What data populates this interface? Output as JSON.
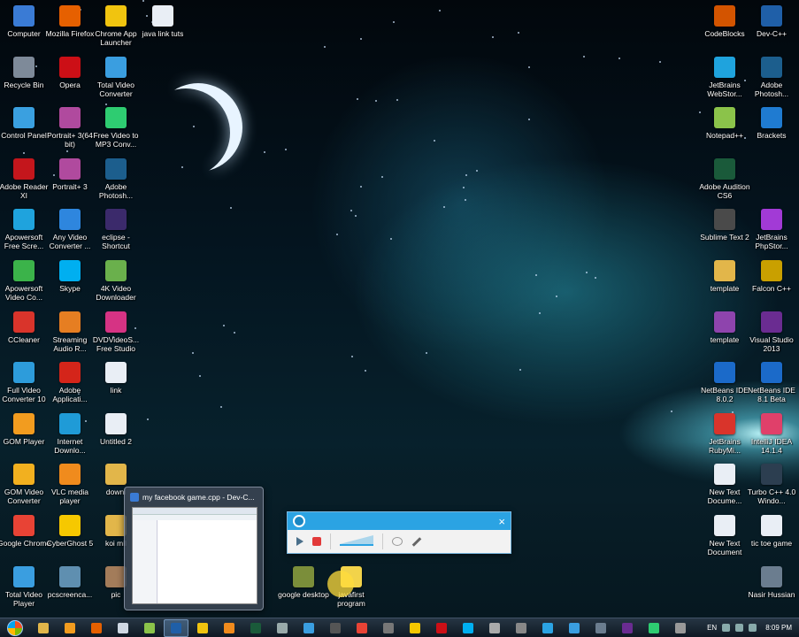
{
  "desktop": {
    "icons_left": [
      {
        "label": "Computer",
        "icon": "computer-icon",
        "color": "#3a7bd5"
      },
      {
        "label": "Recycle Bin",
        "icon": "recycle-bin-icon",
        "color": "#7e8a99"
      },
      {
        "label": "Control Panel",
        "icon": "control-panel-icon",
        "color": "#3aa0e0"
      },
      {
        "label": "Adobe Reader XI",
        "icon": "adobe-reader-icon",
        "color": "#c4161c"
      },
      {
        "label": "Apowersoft Free Scre...",
        "icon": "apowersoft-icon",
        "color": "#1fa3dd"
      },
      {
        "label": "Apowersoft Video Co...",
        "icon": "apowersoft-video-icon",
        "color": "#3bb34a"
      },
      {
        "label": "CCleaner",
        "icon": "ccleaner-icon",
        "color": "#d9342b"
      },
      {
        "label": "Full Video Converter 10",
        "icon": "full-video-converter-icon",
        "color": "#2d9cdb"
      },
      {
        "label": "GOM Player",
        "icon": "gom-player-icon",
        "color": "#f29c1f"
      },
      {
        "label": "GOM Video Converter",
        "icon": "gom-video-converter-icon",
        "color": "#f2b01f"
      },
      {
        "label": "Google Chrome",
        "icon": "chrome-icon",
        "color": "#e84335"
      },
      {
        "label": "Total Video Player",
        "icon": "total-video-player-icon",
        "color": "#3a9ee0"
      }
    ],
    "icons_col2": [
      {
        "label": "Mozilla Firefox",
        "icon": "firefox-icon",
        "color": "#e66000"
      },
      {
        "label": "Opera",
        "icon": "opera-icon",
        "color": "#cc0f16"
      },
      {
        "label": "Portrait+ 3(64 bit)",
        "icon": "portrait-icon",
        "color": "#b04a9e"
      },
      {
        "label": "Portrait+ 3",
        "icon": "portrait-icon",
        "color": "#b04a9e"
      },
      {
        "label": "Any Video Converter ...",
        "icon": "any-video-converter-icon",
        "color": "#2e86de"
      },
      {
        "label": "Skype",
        "icon": "skype-icon",
        "color": "#00aff0"
      },
      {
        "label": "Streaming Audio R...",
        "icon": "streaming-audio-icon",
        "color": "#e67e22"
      },
      {
        "label": "Adobe Applicati...",
        "icon": "adobe-app-icon",
        "color": "#d4251a"
      },
      {
        "label": "Internet Downlo...",
        "icon": "internet-download-icon",
        "color": "#1f9bd7"
      },
      {
        "label": "VLC media player",
        "icon": "vlc-icon",
        "color": "#f08b1d"
      },
      {
        "label": "CyberGhost 5",
        "icon": "cyberghost-icon",
        "color": "#f6c800"
      },
      {
        "label": "pcscreenca...",
        "icon": "screencast-icon",
        "color": "#5f8fb0"
      }
    ],
    "icons_col3": [
      {
        "label": "Chrome App Launcher",
        "icon": "chrome-app-launcher-icon",
        "color": "#f1c40f"
      },
      {
        "label": "Total Video Converter",
        "icon": "total-video-converter-icon",
        "color": "#3a9ee0"
      },
      {
        "label": "Free Video to MP3 Conv...",
        "icon": "free-video-mp3-icon",
        "color": "#2ecc71"
      },
      {
        "label": "Adobe Photosh...",
        "icon": "photoshop-icon",
        "color": "#1c5e8d"
      },
      {
        "label": "eclipse - Shortcut",
        "icon": "eclipse-icon",
        "color": "#3b2a6b"
      },
      {
        "label": "4K Video Downloader",
        "icon": "4k-video-icon",
        "color": "#6ab04c"
      },
      {
        "label": "DVDVideoS... Free Studio",
        "icon": "dvdvideosoft-icon",
        "color": "#d63384"
      },
      {
        "label": "link",
        "icon": "file-icon",
        "color": "#e9eef5"
      },
      {
        "label": "Untitled 2",
        "icon": "file-icon",
        "color": "#e9eef5"
      },
      {
        "label": "downl",
        "icon": "folder-icon",
        "color": "#e2b64a"
      },
      {
        "label": "koi mil",
        "icon": "folder-icon",
        "color": "#e2b64a"
      },
      {
        "label": "pic",
        "icon": "image-icon",
        "color": "#a37c5a"
      }
    ],
    "icons_col4": [
      {
        "label": "java link tuts",
        "icon": "file-icon",
        "color": "#e9eef5"
      }
    ],
    "icons_right1": [
      {
        "label": "CodeBlocks",
        "icon": "codeblocks-icon",
        "color": "#d35400"
      },
      {
        "label": "JetBrains WebStor...",
        "icon": "webstorm-icon",
        "color": "#1fa3dd"
      },
      {
        "label": "Notepad++",
        "icon": "notepadpp-icon",
        "color": "#8bc34a"
      },
      {
        "label": "Adobe Audition CS6",
        "icon": "audition-icon",
        "color": "#1a5a3a"
      },
      {
        "label": "Sublime Text 2",
        "icon": "sublime-icon",
        "color": "#4a4a4a"
      },
      {
        "label": "template",
        "icon": "folder-icon",
        "color": "#e2b64a"
      },
      {
        "label": "template",
        "icon": "winrar-icon",
        "color": "#8e44ad"
      },
      {
        "label": "NetBeans IDE 8.0.2",
        "icon": "netbeans-icon",
        "color": "#1b6ac9"
      },
      {
        "label": "JetBrains RubyMi...",
        "icon": "rubymine-icon",
        "color": "#d9342b"
      },
      {
        "label": "New Text Docume...",
        "icon": "text-doc-icon",
        "color": "#e9eef5"
      },
      {
        "label": "New Text Document",
        "icon": "text-doc-icon",
        "color": "#e9eef5"
      }
    ],
    "icons_right2": [
      {
        "label": "Dev-C++",
        "icon": "devcpp-icon",
        "color": "#1f5fa8"
      },
      {
        "label": "Adobe Photosh...",
        "icon": "photoshop-icon",
        "color": "#1c5e8d"
      },
      {
        "label": "Brackets",
        "icon": "brackets-icon",
        "color": "#1f7bd1"
      },
      {
        "label": "",
        "icon": "none",
        "color": "transparent"
      },
      {
        "label": "JetBrains PhpStor...",
        "icon": "phpstorm-icon",
        "color": "#a23ad6"
      },
      {
        "label": "Falcon C++",
        "icon": "falcon-icon",
        "color": "#c9a000"
      },
      {
        "label": "Visual Studio 2013",
        "icon": "visual-studio-icon",
        "color": "#6a2c91"
      },
      {
        "label": "NetBeans IDE 8.1 Beta",
        "icon": "netbeans-icon",
        "color": "#1b6ac9"
      },
      {
        "label": "IntelliJ IDEA 14.1.4",
        "icon": "intellij-icon",
        "color": "#e0406a"
      },
      {
        "label": "Turbo C++ 4.0 Windo...",
        "icon": "turbo-cpp-icon",
        "color": "#2c3e50"
      },
      {
        "label": "tic toe game",
        "icon": "text-doc-icon",
        "color": "#e9eef5"
      },
      {
        "label": "Nasir Hussian",
        "icon": "user-folder-icon",
        "color": "#6b7d8f"
      }
    ],
    "icons_bottom": [
      {
        "label": "google desktop",
        "icon": "google-desktop-icon",
        "color": "#7b8e3a"
      },
      {
        "label": "javafirst program",
        "icon": "folder-icon",
        "color": "#f2d34a"
      }
    ]
  },
  "thumbnail": {
    "title": "my facebook game.cpp - Dev-C..."
  },
  "recorder": {
    "close": "×"
  },
  "taskbar": {
    "language": "EN",
    "clock": "8:09 PM",
    "buttons": [
      {
        "icon": "explorer-icon",
        "color": "#e2b64a"
      },
      {
        "icon": "media-player-icon",
        "color": "#f29c1f"
      },
      {
        "icon": "firefox-icon",
        "color": "#e66000"
      },
      {
        "icon": "file-icon",
        "color": "#cfd8e3"
      },
      {
        "icon": "notepad-icon",
        "color": "#8bc34a"
      },
      {
        "icon": "devcpp-icon",
        "color": "#1f5fa8"
      },
      {
        "icon": "chrome-app-icon",
        "color": "#f1c40f"
      },
      {
        "icon": "vlc-icon",
        "color": "#f08b1d"
      },
      {
        "icon": "audition-icon",
        "color": "#1a5a3a"
      },
      {
        "icon": "settings-icon",
        "color": "#9aa"
      },
      {
        "icon": "photo-icon",
        "color": "#3a9ee0"
      },
      {
        "icon": "terminal-icon",
        "color": "#555"
      },
      {
        "icon": "chrome-icon",
        "color": "#e84335"
      },
      {
        "icon": "app-icon",
        "color": "#777"
      },
      {
        "icon": "pacman-icon",
        "color": "#f6c800"
      },
      {
        "icon": "opera-icon",
        "color": "#cc0f16"
      },
      {
        "icon": "skype-icon",
        "color": "#00aff0"
      },
      {
        "icon": "eye-icon",
        "color": "#aaa"
      },
      {
        "icon": "monitor-icon",
        "color": "#888"
      },
      {
        "icon": "recorder-icon",
        "color": "#2ba3e3"
      },
      {
        "icon": "display-icon",
        "color": "#3a9ee0"
      },
      {
        "icon": "window-icon",
        "color": "#6b7d8f"
      },
      {
        "icon": "visual-studio-icon",
        "color": "#6a2c91"
      },
      {
        "icon": "phone-icon",
        "color": "#2ecc71"
      },
      {
        "icon": "grid-icon",
        "color": "#999"
      }
    ]
  }
}
